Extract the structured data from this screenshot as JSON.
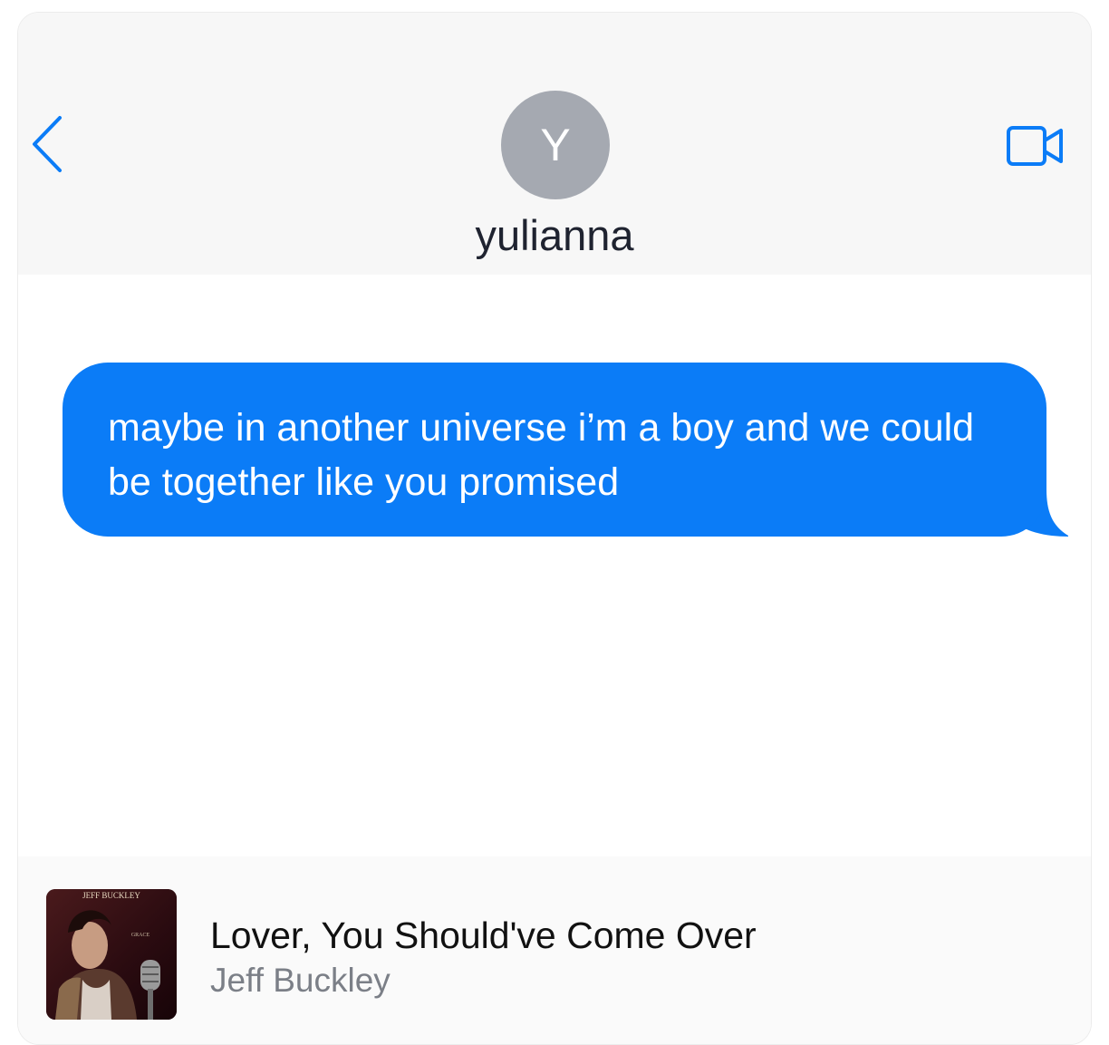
{
  "header": {
    "avatar_initial": "Y",
    "contact_name": "yulianna",
    "back_icon": "chevron-left-icon",
    "video_icon": "video-camera-icon",
    "accent_color": "#0b7cf7"
  },
  "messages": [
    {
      "direction": "outgoing",
      "text": "maybe in another universe i’m a boy and we could be together like you promised",
      "bubble_color": "#0b7cf7"
    }
  ],
  "now_playing": {
    "album_label": "JEFF BUCKLEY",
    "album_sublabel": "GRACE",
    "song_title": "Lover, You Should've Come Over",
    "artist": "Jeff Buckley"
  }
}
